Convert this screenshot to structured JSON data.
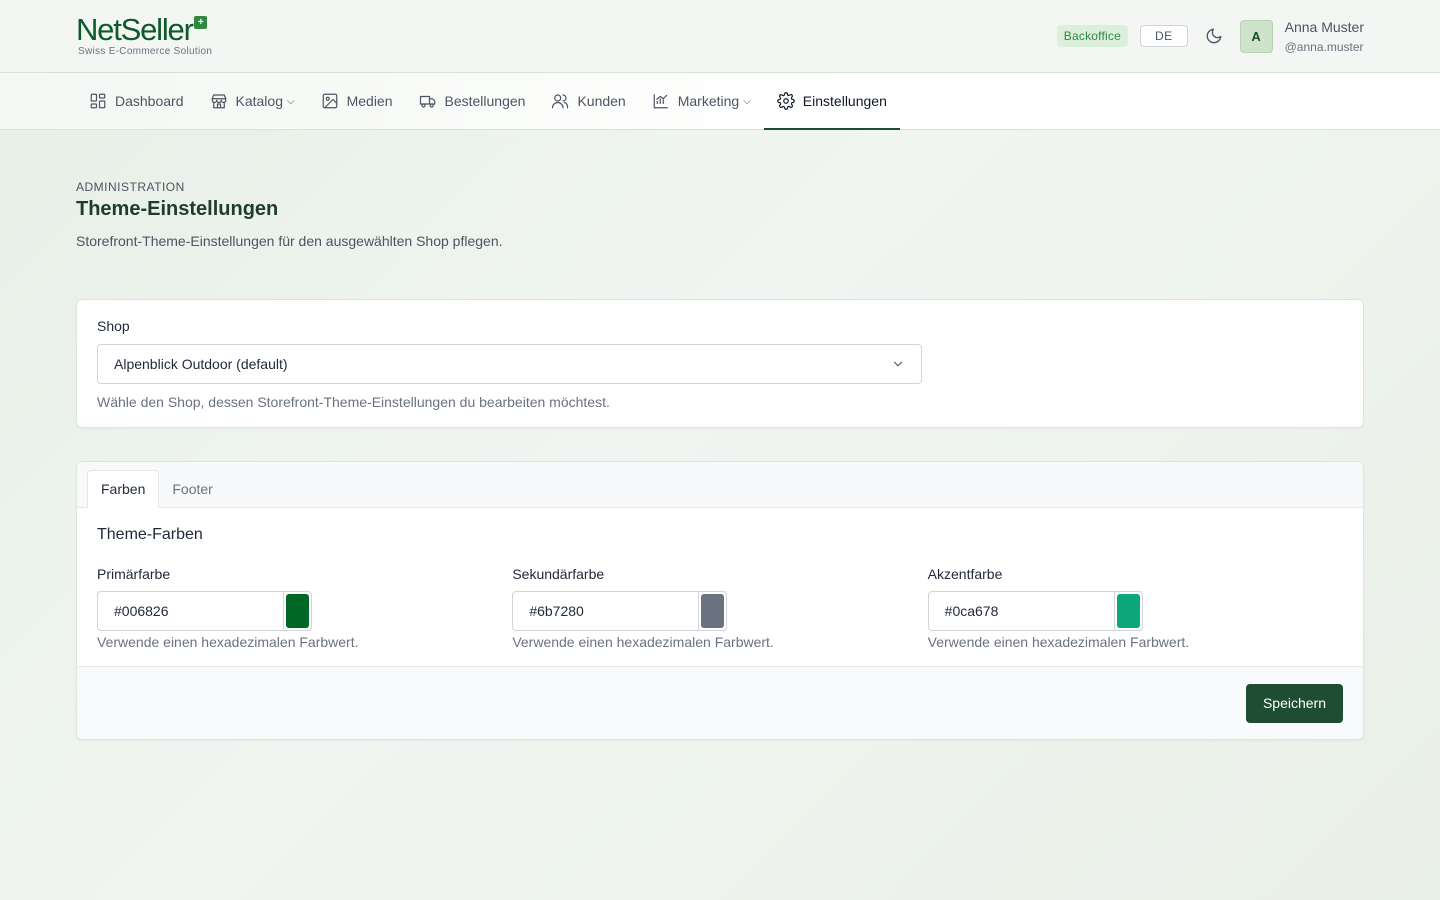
{
  "header": {
    "logo": {
      "net": "Net",
      "seller": "Seller",
      "subtitle": "Swiss E-Commerce Solution"
    },
    "badge": "Backoffice",
    "language": "DE",
    "user": {
      "initial": "A",
      "name": "Anna Muster",
      "handle": "@anna.muster"
    }
  },
  "nav": {
    "items": [
      {
        "label": "Dashboard",
        "icon": "dashboard-icon"
      },
      {
        "label": "Katalog",
        "icon": "store-icon",
        "dropdown": true
      },
      {
        "label": "Medien",
        "icon": "image-icon"
      },
      {
        "label": "Bestellungen",
        "icon": "truck-icon"
      },
      {
        "label": "Kunden",
        "icon": "users-icon"
      },
      {
        "label": "Marketing",
        "icon": "chart-icon",
        "dropdown": true
      },
      {
        "label": "Einstellungen",
        "icon": "gear-icon",
        "active": true
      }
    ]
  },
  "page": {
    "eyebrow": "ADMINISTRATION",
    "title": "Theme-Einstellungen",
    "description": "Storefront-Theme-Einstellungen für den ausgewählten Shop pflegen."
  },
  "shop": {
    "label": "Shop",
    "selected": "Alpenblick Outdoor (default)",
    "help": "Wähle den Shop, dessen Storefront-Theme-Einstellungen du bearbeiten möchtest."
  },
  "tabs": [
    {
      "label": "Farben",
      "active": true
    },
    {
      "label": "Footer",
      "active": false
    }
  ],
  "colors": {
    "section_title": "Theme-Farben",
    "fields": [
      {
        "label": "Primärfarbe",
        "value": "#006826",
        "help": "Verwende einen hexadezimalen Farbwert."
      },
      {
        "label": "Sekundärfarbe",
        "value": "#6b7280",
        "help": "Verwende einen hexadezimalen Farbwert."
      },
      {
        "label": "Akzentfarbe",
        "value": "#0ca678",
        "help": "Verwende einen hexadezimalen Farbwert."
      }
    ]
  },
  "footer": {
    "save_label": "Speichern"
  },
  "theme": {
    "brand": "#1f4d34",
    "logo_green": "#0d5a2c",
    "badge_green": "#2e8b3e"
  }
}
